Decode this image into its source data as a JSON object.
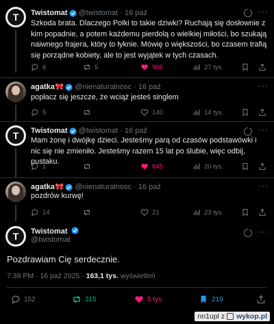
{
  "tweets": [
    {
      "author": "Twistomat",
      "handle": "@twistomat",
      "date": "16 paź",
      "text": "Szkoda brata. Dlaczego Polki to takie dziwki? Ruchają się dosłownie z kim popadnie, a potem każdemu pierdolą o wielkiej miłości, bo szukają naiwnego frajera, który to łyknie. Mówię o większości, bo czasem trafią się porządne kobiety, ale to jest wyjątek w tych czasach.",
      "replies": "6",
      "reposts": "5",
      "likes": "906",
      "views": "27 tys."
    },
    {
      "author": "agatka",
      "handle": "@nienaturalnosc",
      "date": "16 paź",
      "text": "popłacz się jeszcze, że wciąż jesteś singlem",
      "replies": "5",
      "reposts": "",
      "likes": "140",
      "views": "14 tys."
    },
    {
      "author": "Twistomat",
      "handle": "@twistomat",
      "date": "16 paź",
      "text": "Mam żonę i dwójkę dzieci. Jesteśmy parą od czasów podstawówki i nic się nie zmieniło. Jesteśmy razem 15 lat po ślubie, więc odbij, pustaku.",
      "replies": "1",
      "reposts": "",
      "likes": "845",
      "views": "20 tys."
    },
    {
      "author": "agatka",
      "handle": "@nienaturalnosc",
      "date": "16 paź",
      "text": "pozdrów kurwę!",
      "replies": "14",
      "reposts": "",
      "likes": "21",
      "views": "23 tys."
    }
  ],
  "main_tweet": {
    "author": "Twistomat",
    "handle": "@twistomat",
    "text": "Pozdrawiam Cię serdecznie.",
    "time": "7:39 PM",
    "date": "16 paź 2025",
    "sep": "·",
    "views_count": "163,1 tys.",
    "views_label": "wyświetleń",
    "replies": "152",
    "reposts": "315",
    "likes": "5 tys.",
    "bookmarks": "219"
  },
  "watermark": {
    "user": "nn1upl",
    "sep": "z",
    "site": "wykop.pl"
  },
  "colors": {
    "background": "#000000",
    "like": "#f91880",
    "repost": "#00ba7c",
    "bookmark": "#1d9bf0",
    "verified": "#1d9bf0",
    "muted": "#71767b"
  }
}
